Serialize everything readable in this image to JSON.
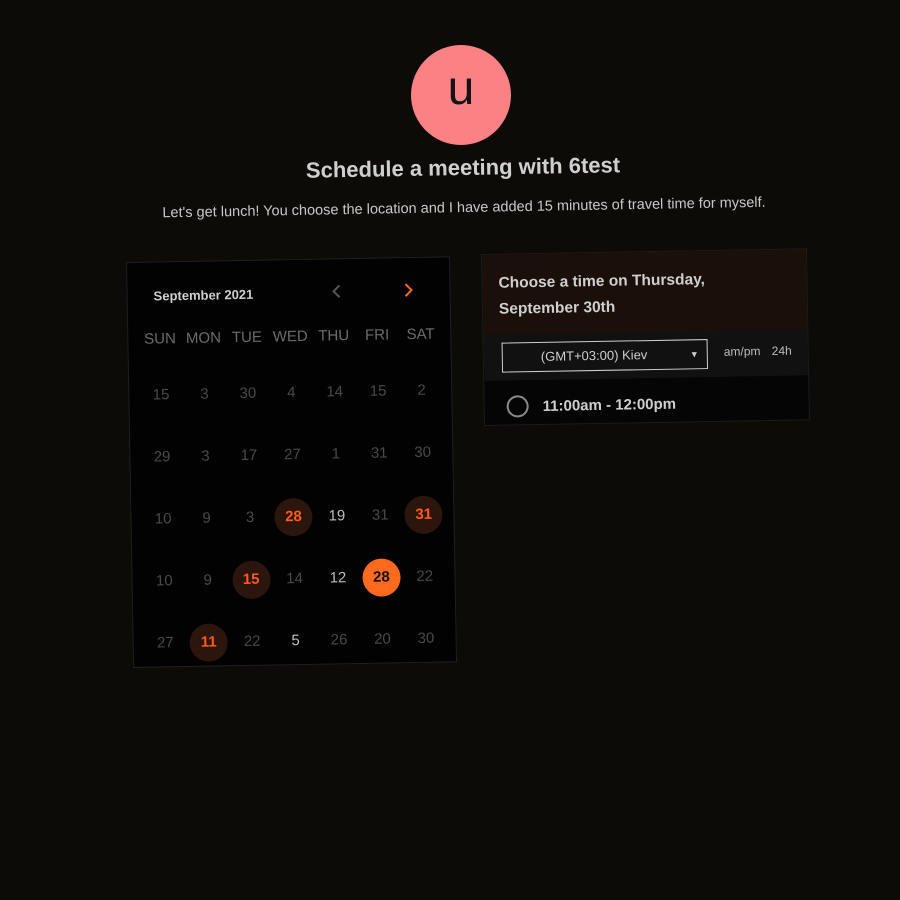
{
  "avatar": {
    "initial": "u",
    "color": "#fb8185"
  },
  "header": {
    "title": "Schedule a meeting with 6test",
    "description": "Let's get lunch! You choose the location and I have added 15 minutes of travel time for myself."
  },
  "calendar": {
    "month_label": "September 2021",
    "prev_icon": "chevron-left-icon",
    "next_icon": "chevron-right-icon",
    "weekdays": [
      "SUN",
      "MON",
      "TUE",
      "WED",
      "THU",
      "FRI",
      "SAT"
    ],
    "weeks": [
      [
        {
          "d": "15",
          "s": "off"
        },
        {
          "d": "3",
          "s": "off"
        },
        {
          "d": "30",
          "s": "off"
        },
        {
          "d": "4",
          "s": "off"
        },
        {
          "d": "14",
          "s": "off"
        },
        {
          "d": "15",
          "s": "off"
        },
        {
          "d": "2",
          "s": "off"
        }
      ],
      [
        {
          "d": "29",
          "s": "off"
        },
        {
          "d": "3",
          "s": "off"
        },
        {
          "d": "17",
          "s": "off"
        },
        {
          "d": "27",
          "s": "off"
        },
        {
          "d": "1",
          "s": "off"
        },
        {
          "d": "31",
          "s": "off"
        },
        {
          "d": "30",
          "s": "off"
        }
      ],
      [
        {
          "d": "10",
          "s": "off"
        },
        {
          "d": "9",
          "s": "off"
        },
        {
          "d": "3",
          "s": "off"
        },
        {
          "d": "28",
          "s": "avail"
        },
        {
          "d": "19",
          "s": "on"
        },
        {
          "d": "31",
          "s": "off"
        },
        {
          "d": "31",
          "s": "avail"
        }
      ],
      [
        {
          "d": "10",
          "s": "off"
        },
        {
          "d": "9",
          "s": "off"
        },
        {
          "d": "15",
          "s": "avail"
        },
        {
          "d": "14",
          "s": "off"
        },
        {
          "d": "12",
          "s": "on"
        },
        {
          "d": "28",
          "s": "sel"
        },
        {
          "d": "22",
          "s": "off"
        }
      ],
      [
        {
          "d": "27",
          "s": "off"
        },
        {
          "d": "11",
          "s": "avail"
        },
        {
          "d": "22",
          "s": "off"
        },
        {
          "d": "5",
          "s": "on"
        },
        {
          "d": "26",
          "s": "off"
        },
        {
          "d": "20",
          "s": "off"
        },
        {
          "d": "30",
          "s": "off"
        }
      ]
    ],
    "accent_color": "#ff6a1f"
  },
  "time_panel": {
    "heading_line1": "Choose a time on Thursday,",
    "heading_line2": "September 30th",
    "timezone": "(GMT+03:00) Kiev",
    "format_ampm": "am/pm",
    "format_24h": "24h",
    "slots": [
      {
        "label": "11:00am - 12:00pm"
      }
    ]
  }
}
